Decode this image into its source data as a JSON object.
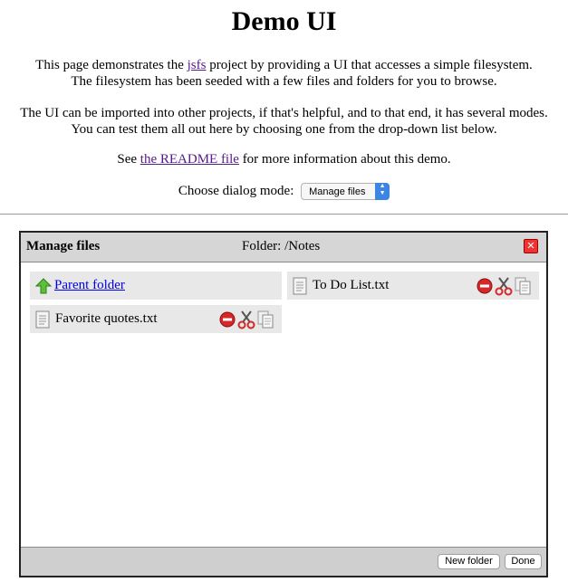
{
  "page": {
    "title": "Demo UI",
    "intro": {
      "before_link": "This page demonstrates the ",
      "link": "jsfs",
      "after_link": " project by providing a UI that accesses a simple filesystem.",
      "line2": "The filesystem has been seeded with a few files and folders for you to browse."
    },
    "modes_text": {
      "line1": "The UI can be imported into other projects, if that's helpful, and to that end, it has several modes.",
      "line2": "You can test them all out here by choosing one from the drop-down list below."
    },
    "readme": {
      "before_link": "See ",
      "link": "the README file",
      "after_link": " for more information about this demo."
    },
    "mode_select": {
      "label": "Choose dialog mode:",
      "selected": "Manage files"
    }
  },
  "dialog": {
    "title": "Manage files",
    "folder_label": "Folder: /Notes",
    "close_icon": "close-icon",
    "items": [
      {
        "label": "Parent folder",
        "icon": "up-arrow-icon",
        "type": "parent"
      },
      {
        "label": "To Do List.txt",
        "icon": "document-icon",
        "type": "file",
        "actions": [
          "delete-icon",
          "cut-icon",
          "copy-icon"
        ]
      },
      {
        "label": "Favorite quotes.txt",
        "icon": "document-icon",
        "type": "file",
        "actions": [
          "delete-icon",
          "cut-icon",
          "copy-icon"
        ]
      }
    ],
    "buttons": {
      "new_folder": "New folder",
      "done": "Done"
    }
  },
  "colors": {
    "visited_link": "#551a8b",
    "link": "#0000ee",
    "header_bg": "#d6d6d6",
    "item_bg": "#e8e8e8",
    "close_red": "#e33333",
    "select_accent": "#3b86e3"
  }
}
